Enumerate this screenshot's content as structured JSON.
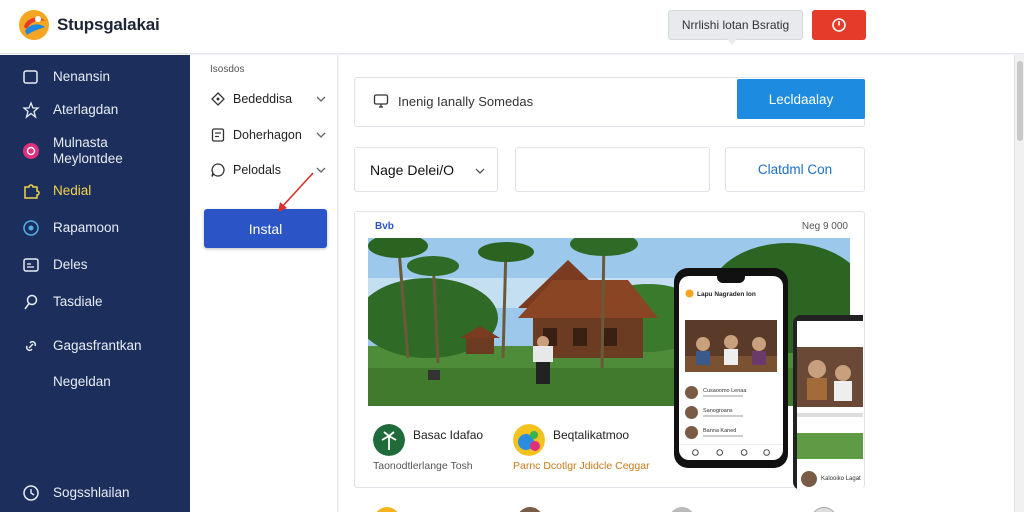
{
  "header": {
    "app_name": "Stupsgalakai",
    "notify_button": "Nrrlishi lotan Bsratig",
    "colors": {
      "accent_red": "#e53b2a",
      "sidebar": "#1c2f5c",
      "primary": "#2b55c7"
    }
  },
  "sidebar": {
    "items": [
      {
        "label": "Nenansin",
        "icon": "square-icon"
      },
      {
        "label": "Aterlagdan",
        "icon": "star-icon"
      },
      {
        "label": "Mulnasta Meylontdee",
        "icon": "pink-badge-icon"
      },
      {
        "label": "Nedial",
        "icon": "puzzle-icon",
        "active": true
      },
      {
        "label": "Rapamoon",
        "icon": "target-icon"
      },
      {
        "label": "Deles",
        "icon": "card-icon"
      },
      {
        "label": "Tasdiale",
        "icon": "pin-icon"
      },
      {
        "label": "Gagasfrantkan",
        "icon": "link-icon"
      },
      {
        "label": "Negeldan",
        "icon": ""
      }
    ],
    "footer_label": "Sogsshlailan"
  },
  "submenu": {
    "title": "Isosdos",
    "items": [
      {
        "label": "Bededdisa",
        "icon": "diamond-icon"
      },
      {
        "label": "Doherhagon",
        "icon": "doc-icon"
      },
      {
        "label": "Pelodals",
        "icon": "chat-icon"
      }
    ],
    "install_label": "Instal"
  },
  "toolbar": {
    "search_text": "Inenig Ianally Somedas",
    "primary_label": "Lecldaalay",
    "select_value": "Nage Delei/O",
    "empty_input_value": "",
    "outline_label": "Clatdml Con"
  },
  "preview": {
    "tag": "Bvb",
    "meta": "Neg 9 000",
    "app1_name": "Basac Idafao",
    "app1_sub": "Taonodtlerlange Tosh",
    "app2_name": "Beqtalikatmoo",
    "app2_sub": "Parnc Dcotlgr Jdidcle Ceggar",
    "phone_title": "Lapu Nagraden Ion",
    "phone_rows": [
      "Cusaoomo Lenaa",
      "Sanogroans",
      "Banna Kaned"
    ],
    "tablet_text": "Kalooiko Lagat"
  }
}
